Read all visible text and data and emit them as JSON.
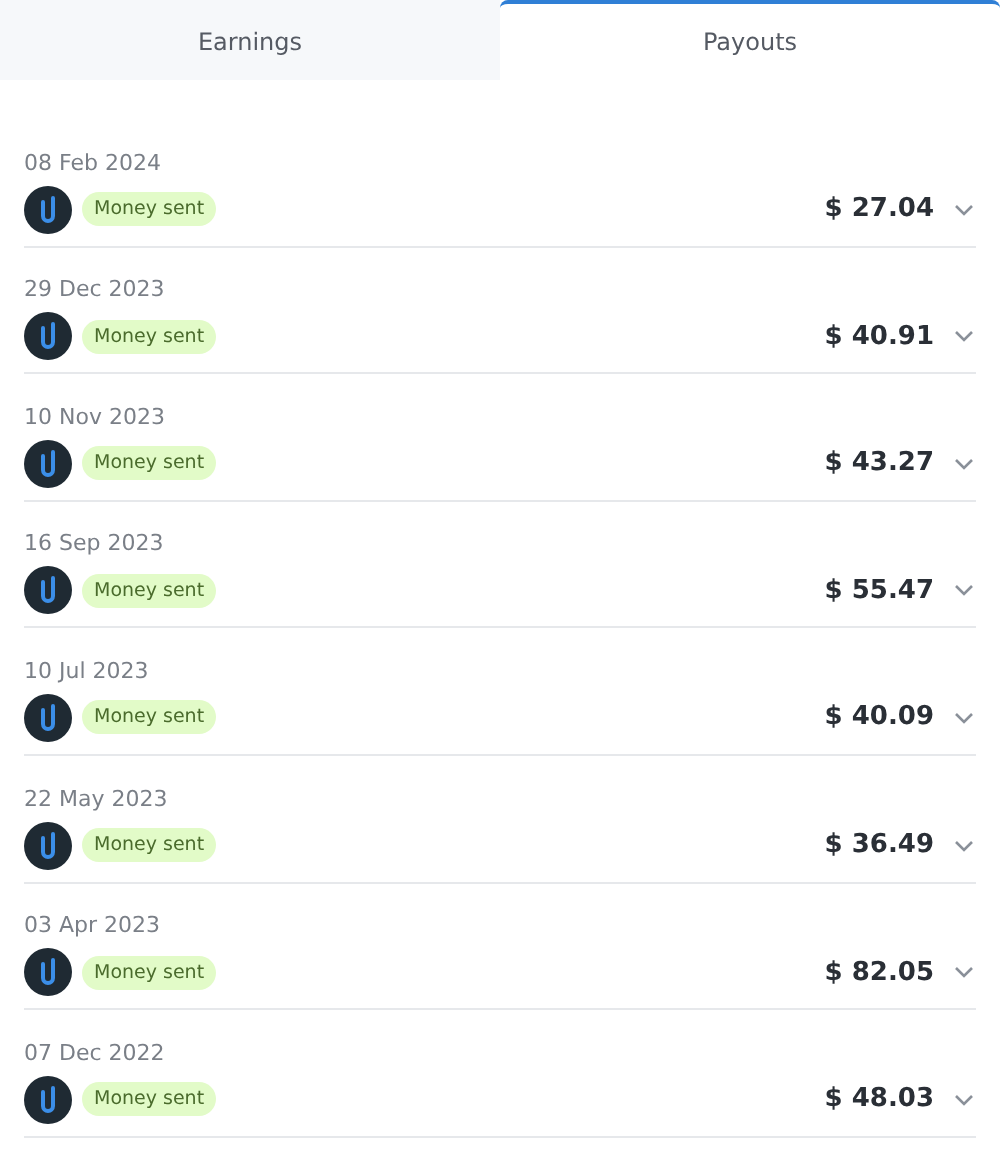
{
  "tabs": [
    {
      "label": "Earnings",
      "selected": false
    },
    {
      "label": "Payouts",
      "selected": true
    }
  ],
  "payouts": [
    {
      "date": "08 Feb 2024",
      "status": "Money sent",
      "amount": "$ 27.04",
      "expanded": false
    },
    {
      "date": "29 Dec 2023",
      "status": "Money sent",
      "amount": "$ 40.91",
      "expanded": false
    },
    {
      "date": "10 Nov 2023",
      "status": "Money sent",
      "amount": "$ 43.27",
      "expanded": false
    },
    {
      "date": "16 Sep 2023",
      "status": "Money sent",
      "amount": "$ 55.47",
      "expanded": false
    },
    {
      "date": "10 Jul 2023",
      "status": "Money sent",
      "amount": "$ 40.09",
      "expanded": false
    },
    {
      "date": "22 May 2023",
      "status": "Money sent",
      "amount": "$ 36.49",
      "expanded": false
    },
    {
      "date": "03 Apr 2023",
      "status": "Money sent",
      "amount": "$ 82.05",
      "expanded": false
    },
    {
      "date": "07 Dec 2022",
      "status": "Money sent",
      "amount": "$ 48.03",
      "expanded": false
    }
  ]
}
